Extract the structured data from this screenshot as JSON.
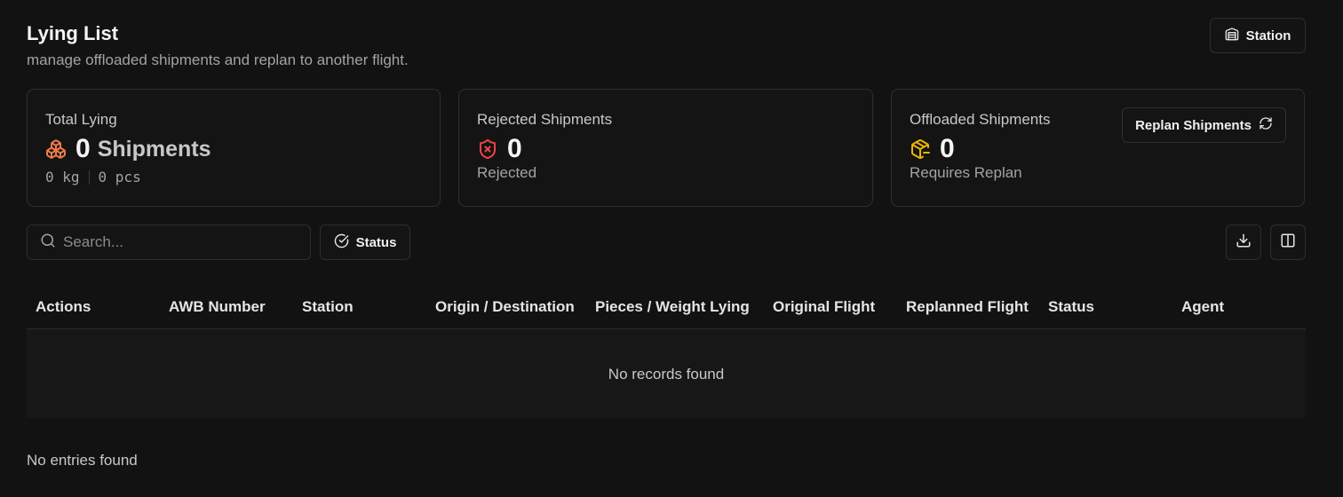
{
  "header": {
    "title": "Lying List",
    "subtitle": "manage offloaded shipments and replan to another flight.",
    "station_label": "Station"
  },
  "cards": {
    "total": {
      "label": "Total Lying",
      "value": "0",
      "unit": "Shipments",
      "weight": "0 kg",
      "pieces": "0 pcs",
      "icon": "boxes-icon",
      "color": "#f07a4a"
    },
    "rejected": {
      "label": "Rejected Shipments",
      "value": "0",
      "sub": "Rejected",
      "icon": "shield-x-icon",
      "color": "#ef4444"
    },
    "offloaded": {
      "label": "Offloaded Shipments",
      "value": "0",
      "sub": "Requires Replan",
      "icon": "package-minus-icon",
      "color": "#eab308",
      "replan_label": "Replan Shipments"
    }
  },
  "toolbar": {
    "search_placeholder": "Search...",
    "status_label": "Status"
  },
  "table": {
    "columns": [
      "Actions",
      "AWB Number",
      "Station",
      "Origin / Destination",
      "Pieces / Weight Lying",
      "Original Flight",
      "Replanned Flight",
      "Status",
      "Agent"
    ],
    "empty_text": "No records found"
  },
  "footer": {
    "text": "No entries found"
  }
}
